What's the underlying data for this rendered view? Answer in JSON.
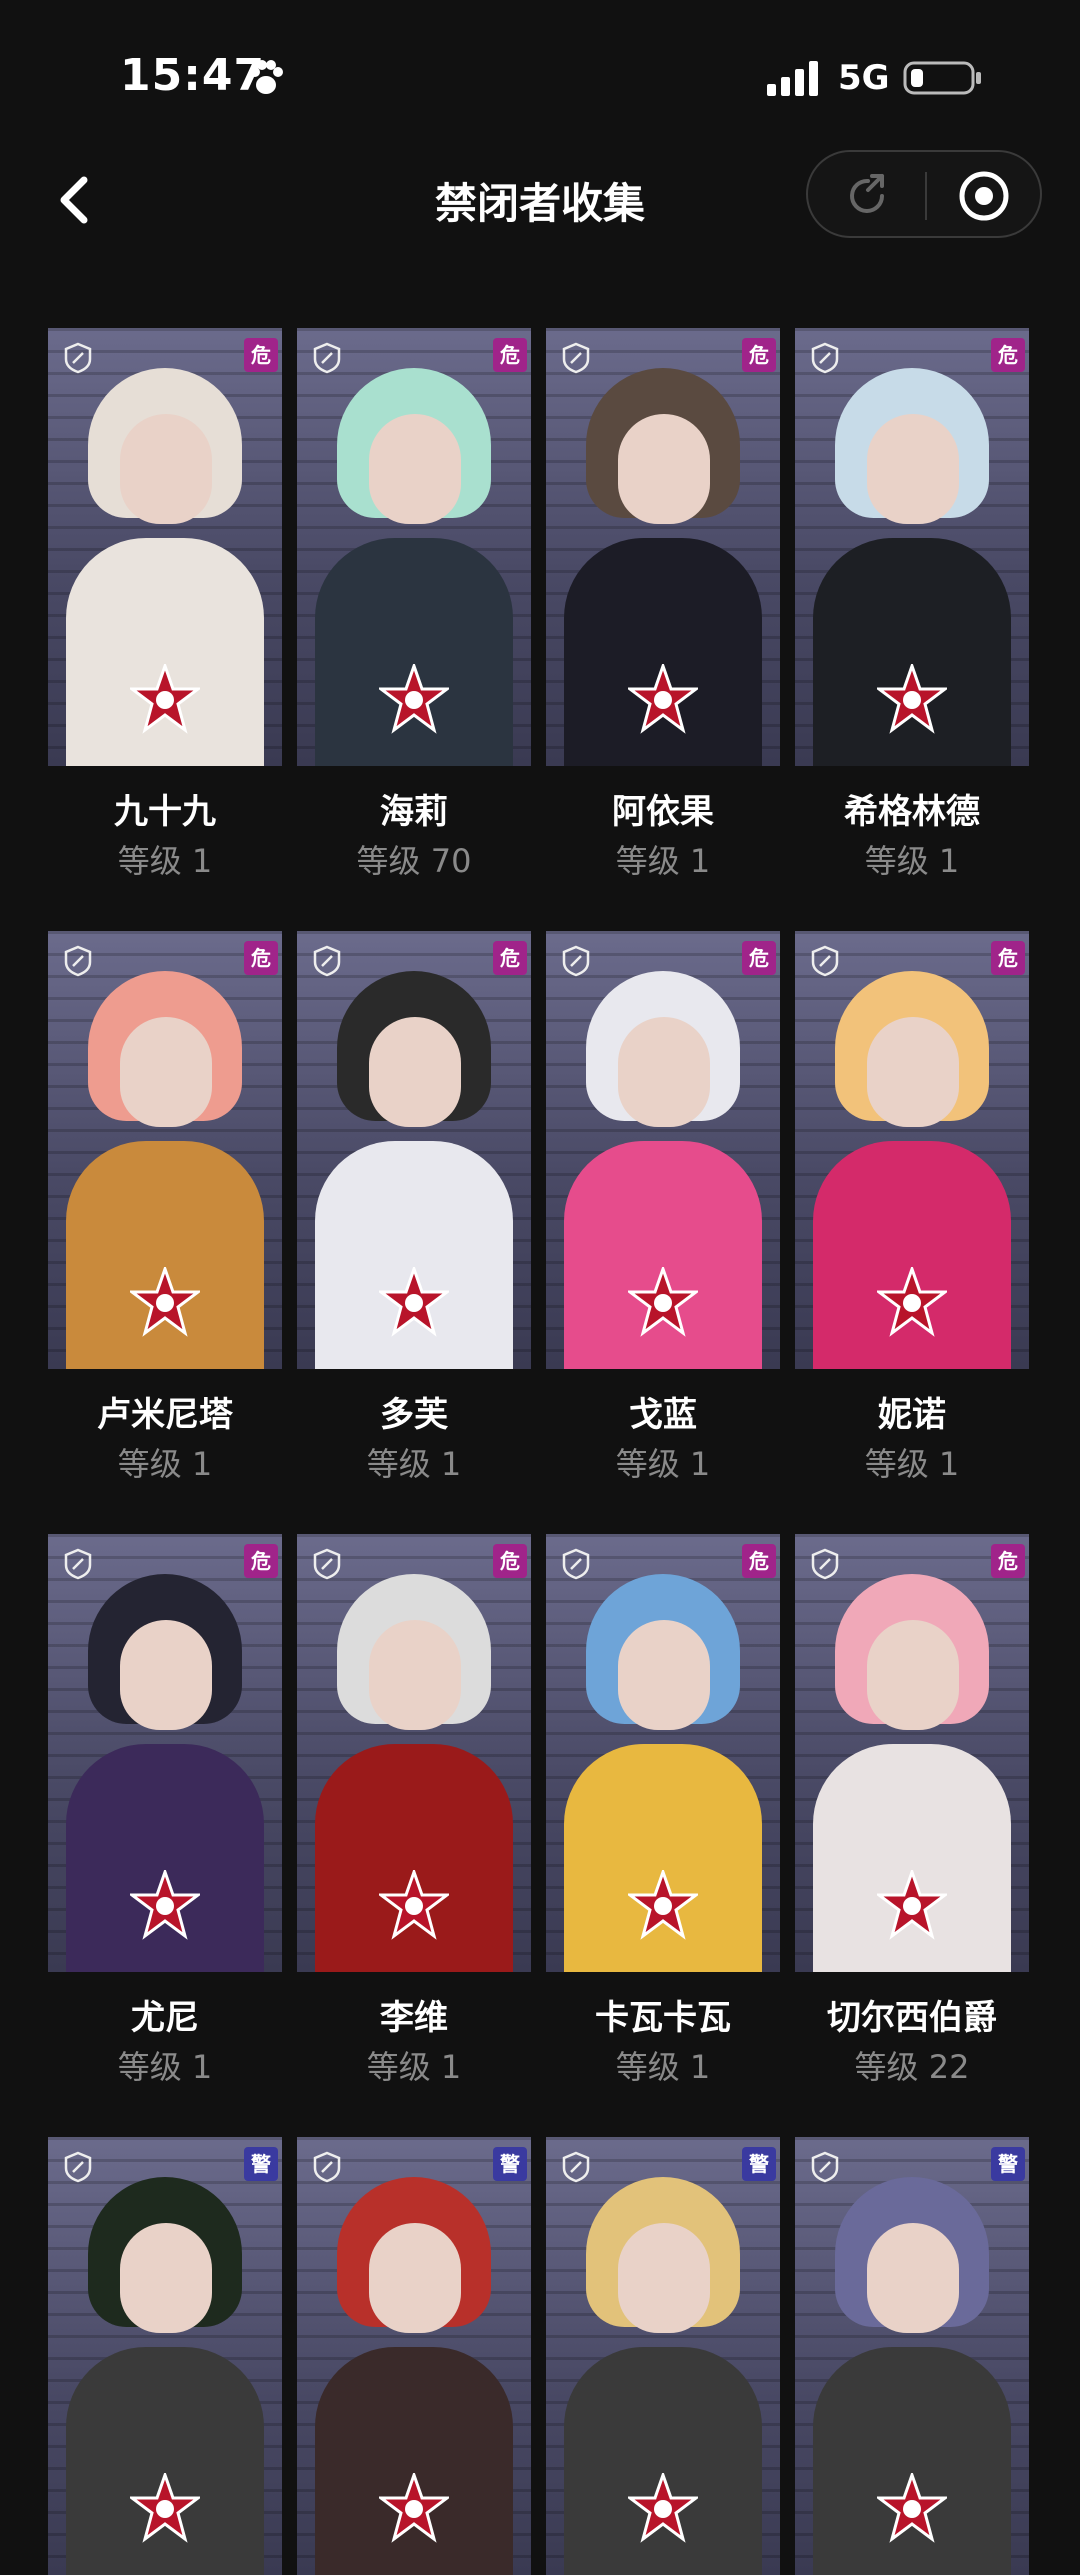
{
  "status": {
    "time": "15:47",
    "network": "5G"
  },
  "nav": {
    "title": "禁闭者收集"
  },
  "labels": {
    "level_prefix": "等级"
  },
  "colors": {
    "background": "#111111",
    "danger": "#a0248a",
    "alert": "#3a3aa0",
    "level_text": "#8a8a8a"
  },
  "cards": [
    {
      "name": "九十九",
      "level_text": "等级 1",
      "hair": "#e6ded6",
      "body": "#e9e3dd",
      "badge": "危"
    },
    {
      "name": "海莉",
      "level_text": "等级 70",
      "hair": "#a9e0cf",
      "body": "#2b3440",
      "badge": "危"
    },
    {
      "name": "阿依果",
      "level_text": "等级 1",
      "hair": "#5a4a40",
      "body": "#1c1c26",
      "badge": "危"
    },
    {
      "name": "希格林德",
      "level_text": "等级 1",
      "hair": "#c7dbe8",
      "body": "#1d1f24",
      "badge": "危"
    },
    {
      "name": "卢米尼塔",
      "level_text": "等级 1",
      "hair": "#ee9c8f",
      "body": "#c98a3c",
      "badge": "危"
    },
    {
      "name": "多芙",
      "level_text": "等级 1",
      "hair": "#2a2a2a",
      "body": "#e8e8ee",
      "badge": "危"
    },
    {
      "name": "戈蓝",
      "level_text": "等级 1",
      "hair": "#e8e8ee",
      "body": "#e64c8c",
      "badge": "危"
    },
    {
      "name": "妮诺",
      "level_text": "等级 1",
      "hair": "#f2c27a",
      "body": "#d42a6a",
      "badge": "危"
    },
    {
      "name": "尤尼",
      "level_text": "等级 1",
      "hair": "#242432",
      "body": "#3c2a5a",
      "badge": "危"
    },
    {
      "name": "李维",
      "level_text": "等级 1",
      "hair": "#dcdcdc",
      "body": "#9a1a1a",
      "badge": "危"
    },
    {
      "name": "卡瓦卡瓦",
      "level_text": "等级 1",
      "hair": "#6ea4d8",
      "body": "#e8b840",
      "badge": "危"
    },
    {
      "name": "切尔西伯爵",
      "level_text": "等级 22",
      "hair": "#f0a8b8",
      "body": "#e8e2e2",
      "badge": "危"
    },
    {
      "name": "",
      "level_text": "",
      "hair": "#1e2a1e",
      "body": "#3a3a3a",
      "badge": "警"
    },
    {
      "name": "",
      "level_text": "",
      "hair": "#b8302a",
      "body": "#3a2a2a",
      "badge": "警"
    },
    {
      "name": "",
      "level_text": "",
      "hair": "#e2c27a",
      "body": "#3a3a3a",
      "badge": "警"
    },
    {
      "name": "",
      "level_text": "",
      "hair": "#6a6a9a",
      "body": "#3a3a3a",
      "badge": "警"
    }
  ]
}
